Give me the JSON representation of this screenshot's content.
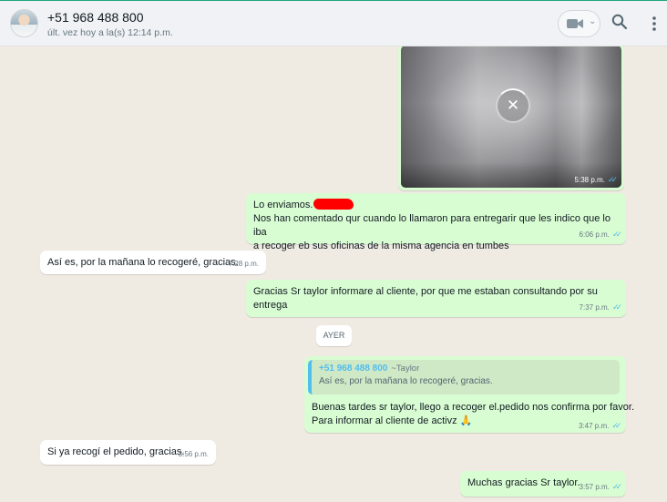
{
  "header": {
    "contact_name": "+51 968 488 800",
    "last_seen": "últ. vez hoy a la(s) 12:14 p.m."
  },
  "media_message": {
    "time": "5:38 p.m.",
    "icon": "close-icon"
  },
  "messages": [
    {
      "direction": "out",
      "lines": [
        "Lo enviamos.",
        "Nos han comentado qur cuando lo llamaron para entregarir que les indico que  lo iba",
        "a recoger eb sus oficinas de la misma agencia en tumbes"
      ],
      "time": "6:06 p.m."
    },
    {
      "direction": "in",
      "text": "Así es, por la mañana lo recogeré, gracias.",
      "time": "7:28 p.m."
    },
    {
      "direction": "out",
      "text": "Gracias Sr taylor informare al cliente, por que me estaban consultando por su entrega",
      "time": "7:37 p.m."
    },
    {
      "direction": "out",
      "quote": {
        "author": "+51 968 488 800",
        "alias": "~Taylor",
        "text": "Así es, por la mañana lo recogeré, gracias."
      },
      "lines": [
        "Buenas tardes sr taylor, llego a recoger el.pedido nos confirma por favor.",
        "Para informar al cliente de activz"
      ],
      "emoji": "🙏",
      "time": "3:47 p.m."
    },
    {
      "direction": "in",
      "text": "Si ya recogí el pedido, gracias.",
      "time": "3:56 p.m."
    },
    {
      "direction": "out",
      "text": "Muchas gracias Sr taylor.",
      "time": "3:57 p.m."
    }
  ],
  "date_divider": "AYER",
  "read_ticks": "✓✓",
  "colors": {
    "chat_background": "#efeae2",
    "outgoing_bubble": "#d9fdd3",
    "incoming_bubble": "#ffffff",
    "read_ticks": "#53bdeb",
    "quote_accent": "#53bdeb",
    "redaction": "#ff0000"
  }
}
